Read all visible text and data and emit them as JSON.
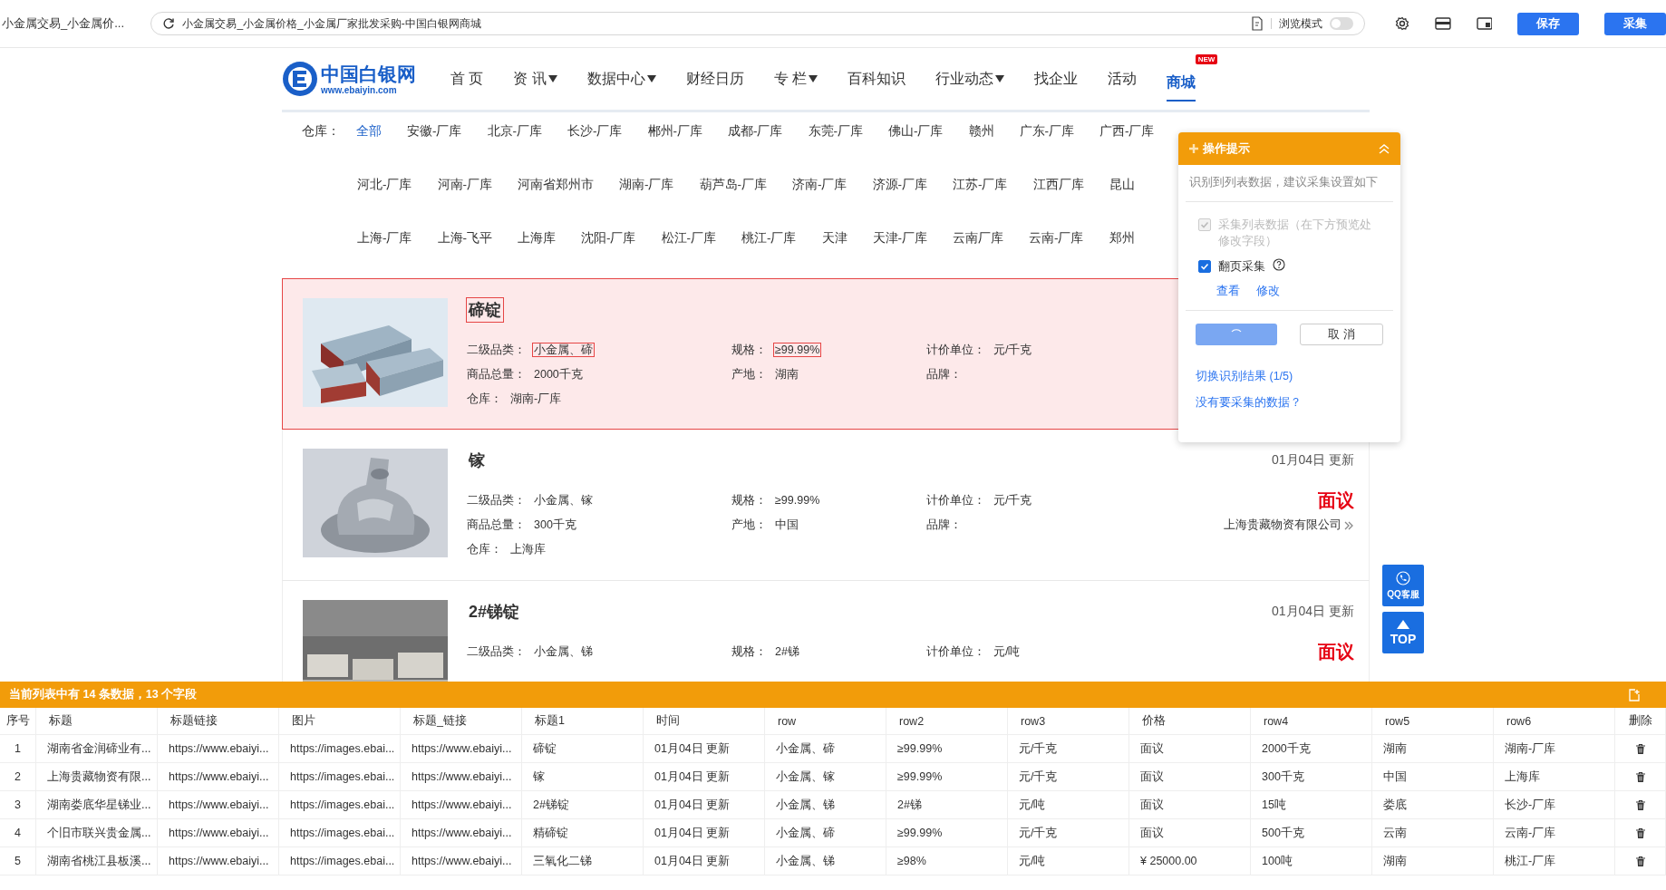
{
  "browser": {
    "tab_title": "小金属交易_小金属价...",
    "address": "小金属交易_小金属价格_小金属厂家批发采购-中国白银网商城",
    "mode_label": "浏览模式",
    "mode_on": false,
    "buttons": [
      {
        "label": "保存"
      },
      {
        "label": "采集"
      }
    ]
  },
  "site": {
    "logo_name": "中国白银网",
    "logo_url": "www.ebaiyin.com",
    "nav": [
      {
        "label": "首 页",
        "dropdown": false,
        "selected": false
      },
      {
        "label": "资 讯",
        "dropdown": true,
        "selected": false
      },
      {
        "label": "数据中心",
        "dropdown": true,
        "selected": false
      },
      {
        "label": "财经日历",
        "dropdown": false,
        "selected": false
      },
      {
        "label": "专 栏",
        "dropdown": true,
        "selected": false
      },
      {
        "label": "百科知识",
        "dropdown": false,
        "selected": false
      },
      {
        "label": "行业动态",
        "dropdown": true,
        "selected": false
      },
      {
        "label": "找企业",
        "dropdown": false,
        "selected": false
      },
      {
        "label": "活动",
        "dropdown": false,
        "selected": false
      },
      {
        "label": "商城",
        "dropdown": false,
        "selected": true,
        "badge": "NEW"
      }
    ]
  },
  "warehouse": {
    "label": "仓库：",
    "rows": [
      {
        "items": [
          {
            "label": "全部",
            "selected": true
          },
          {
            "label": "安徽-厂库",
            "selected": false
          },
          {
            "label": "北京-厂库",
            "selected": false
          },
          {
            "label": "长沙-厂库",
            "selected": false
          },
          {
            "label": "郴州-厂库",
            "selected": false
          },
          {
            "label": "成都-厂库",
            "selected": false
          },
          {
            "label": "东莞-厂库",
            "selected": false
          },
          {
            "label": "佛山-厂库",
            "selected": false
          },
          {
            "label": "赣州",
            "selected": false
          },
          {
            "label": "广东-厂库",
            "selected": false
          },
          {
            "label": "广西-厂库",
            "selected": false
          }
        ]
      },
      {
        "items": [
          {
            "label": "河北-厂库",
            "selected": false
          },
          {
            "label": "河南-厂库",
            "selected": false
          },
          {
            "label": "河南省郑州市",
            "selected": false
          },
          {
            "label": "湖南-厂库",
            "selected": false
          },
          {
            "label": "葫芦岛-厂库",
            "selected": false
          },
          {
            "label": "济南-厂库",
            "selected": false
          },
          {
            "label": "济源-厂库",
            "selected": false
          },
          {
            "label": "江苏-厂库",
            "selected": false
          },
          {
            "label": "江西厂库",
            "selected": false
          },
          {
            "label": "昆山",
            "selected": false
          }
        ]
      },
      {
        "items": [
          {
            "label": "上海-厂库",
            "selected": false
          },
          {
            "label": "上海-飞平",
            "selected": false
          },
          {
            "label": "上海库",
            "selected": false
          },
          {
            "label": "沈阳-厂库",
            "selected": false
          },
          {
            "label": "松江-厂库",
            "selected": false
          },
          {
            "label": "桃江-厂库",
            "selected": false
          },
          {
            "label": "天津",
            "selected": false
          },
          {
            "label": "天津-厂库",
            "selected": false
          },
          {
            "label": "云南厂库",
            "selected": false
          },
          {
            "label": "云南-厂库",
            "selected": false
          },
          {
            "label": "郑州",
            "selected": false
          }
        ]
      }
    ]
  },
  "products": [
    {
      "title": "碲锭",
      "highlighted": true,
      "title_outlined": true,
      "fields": [
        {
          "label": "二级品类：",
          "value": "小金属、碲",
          "outlined": true
        },
        {
          "label": "规格：",
          "value": "≥99.99%",
          "outlined": true
        },
        {
          "label": "计价单位：",
          "value": "元/千克",
          "outlined": false
        },
        {
          "label": "商品总量：",
          "value": "2000千克",
          "outlined": false
        },
        {
          "label": "产地：",
          "value": "湖南",
          "outlined": false
        },
        {
          "label": "品牌："
        },
        {
          "label": "仓库：",
          "value": "湖南-厂库",
          "outlined": false
        }
      ]
    },
    {
      "title": "镓",
      "highlighted": false,
      "title_outlined": false,
      "date": "01月04日 更新",
      "price": "面议",
      "company": "上海贵藏物资有限公司",
      "fields": [
        {
          "label": "二级品类：",
          "value": "小金属、镓",
          "outlined": false
        },
        {
          "label": "规格：",
          "value": "≥99.99%",
          "outlined": false
        },
        {
          "label": "计价单位：",
          "value": "元/千克",
          "outlined": false
        },
        {
          "label": "商品总量：",
          "value": "300千克",
          "outlined": false
        },
        {
          "label": "产地：",
          "value": "中国",
          "outlined": false
        },
        {
          "label": "品牌："
        },
        {
          "label": "仓库：",
          "value": "上海库",
          "outlined": false
        }
      ]
    },
    {
      "title": "2#锑锭",
      "highlighted": false,
      "title_outlined": false,
      "date": "01月04日 更新",
      "price": "面议",
      "fields": [
        {
          "label": "二级品类：",
          "value": "小金属、锑",
          "outlined": false
        },
        {
          "label": "规格：",
          "value": "2#锑",
          "outlined": false
        },
        {
          "label": "计价单位：",
          "value": "元/吨",
          "outlined": false
        }
      ]
    }
  ],
  "popup": {
    "title": "操作提示",
    "hint": "识别到列表数据，建议采集设置如下",
    "options": [
      {
        "label": "采集列表数据（在下方预览处修改字段）",
        "checked": true,
        "disabled": true,
        "help": false
      },
      {
        "label": "翻页采集",
        "checked": true,
        "disabled": false,
        "help": true
      }
    ],
    "links": [
      "查看",
      "修改"
    ],
    "confirm_loading": true,
    "cancel": "取 消",
    "switch_link": "切换识别结果 (1/5)",
    "none_link": "没有要采集的数据？"
  },
  "float_buttons": [
    {
      "kind": "qq",
      "label": "QQ客服"
    },
    {
      "kind": "top",
      "label": "TOP"
    }
  ],
  "preview": {
    "summary": "当前列表中有 14 条数据，13 个字段",
    "columns": [
      "序号",
      "标题",
      "标题链接",
      "图片",
      "标题_链接",
      "标题1",
      "时间",
      "row",
      "row2",
      "row3",
      "价格",
      "row4",
      "row5",
      "row6",
      "删除"
    ],
    "rows": [
      {
        "cells": [
          "1",
          "湖南省金润碲业有...",
          "https://www.ebaiyi...",
          "https://images.ebai...",
          "https://www.ebaiyi...",
          "碲锭",
          "01月04日 更新",
          "小金属、碲",
          "≥99.99%",
          "元/千克",
          "面议",
          "2000千克",
          "湖南",
          "湖南-厂库"
        ]
      },
      {
        "cells": [
          "2",
          "上海贵藏物资有限...",
          "https://www.ebaiyi...",
          "https://images.ebai...",
          "https://www.ebaiyi...",
          "镓",
          "01月04日 更新",
          "小金属、镓",
          "≥99.99%",
          "元/千克",
          "面议",
          "300千克",
          "中国",
          "上海库"
        ]
      },
      {
        "cells": [
          "3",
          "湖南娄底华星锑业...",
          "https://www.ebaiyi...",
          "https://images.ebai...",
          "https://www.ebaiyi...",
          "2#锑锭",
          "01月04日 更新",
          "小金属、锑",
          "2#锑",
          "元/吨",
          "面议",
          "15吨",
          "娄底",
          "长沙-厂库"
        ]
      },
      {
        "cells": [
          "4",
          "个旧市联兴贵金属...",
          "https://www.ebaiyi...",
          "https://images.ebai...",
          "https://www.ebaiyi...",
          "精碲锭",
          "01月04日 更新",
          "小金属、碲",
          "≥99.99%",
          "元/千克",
          "面议",
          "500千克",
          "云南",
          "云南-厂库"
        ]
      },
      {
        "cells": [
          "5",
          "湖南省桃江县板溪...",
          "https://www.ebaiyi...",
          "https://images.ebai...",
          "https://www.ebaiyi...",
          "三氧化二锑",
          "01月04日 更新",
          "小金属、锑",
          "≥98%",
          "元/吨",
          "¥ 25000.00",
          "100吨",
          "湖南",
          "桃江-厂库"
        ]
      }
    ]
  }
}
